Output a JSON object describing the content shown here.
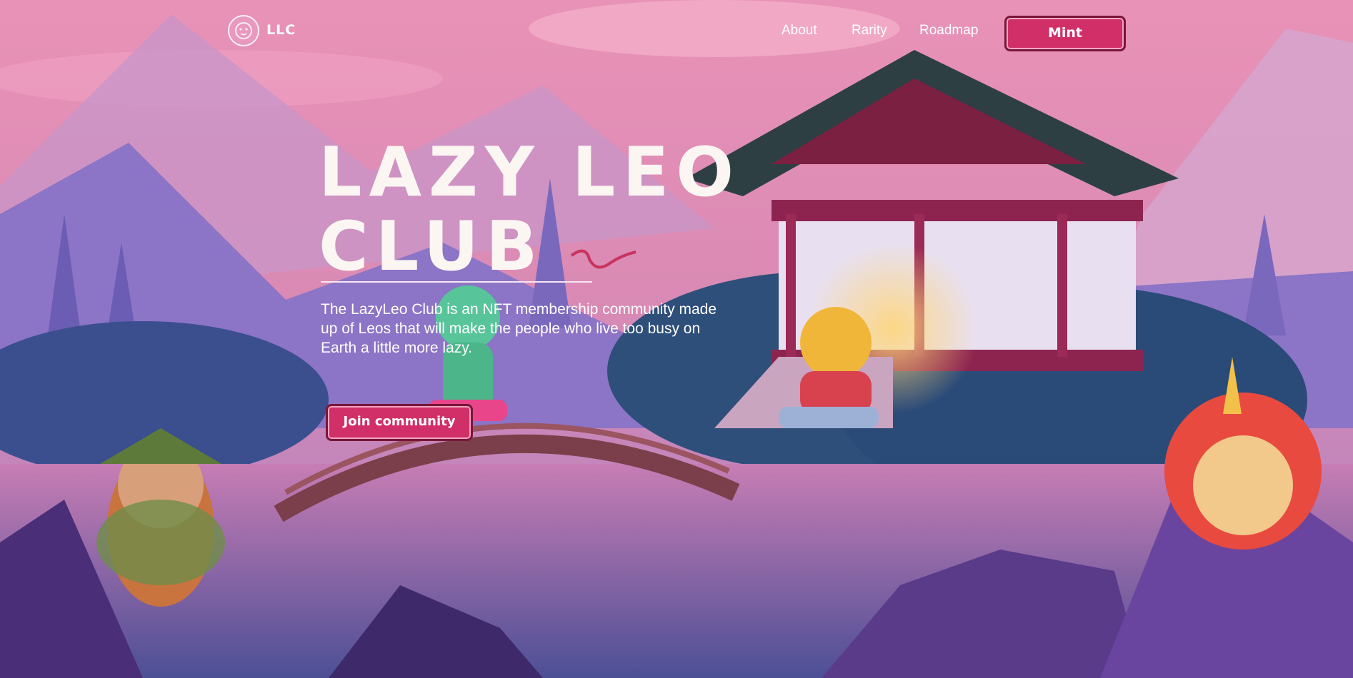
{
  "nav": {
    "logo_text": "LLC",
    "links": [
      "About",
      "Rarity",
      "Roadmap"
    ],
    "mint_label": "Mint"
  },
  "hero": {
    "title_line1": "LAZY LEO",
    "title_line2": "CLUB",
    "description": "The LazyLeo Club is an NFT membership community made up of Leos that will make the people who live too busy on Earth a little more lazy.",
    "cta_label": "Join community"
  },
  "colors": {
    "accent": "#d12f67",
    "sky_top": "#e98fb4",
    "mountain": "#8a6fc0",
    "water": "#3c5a98"
  }
}
